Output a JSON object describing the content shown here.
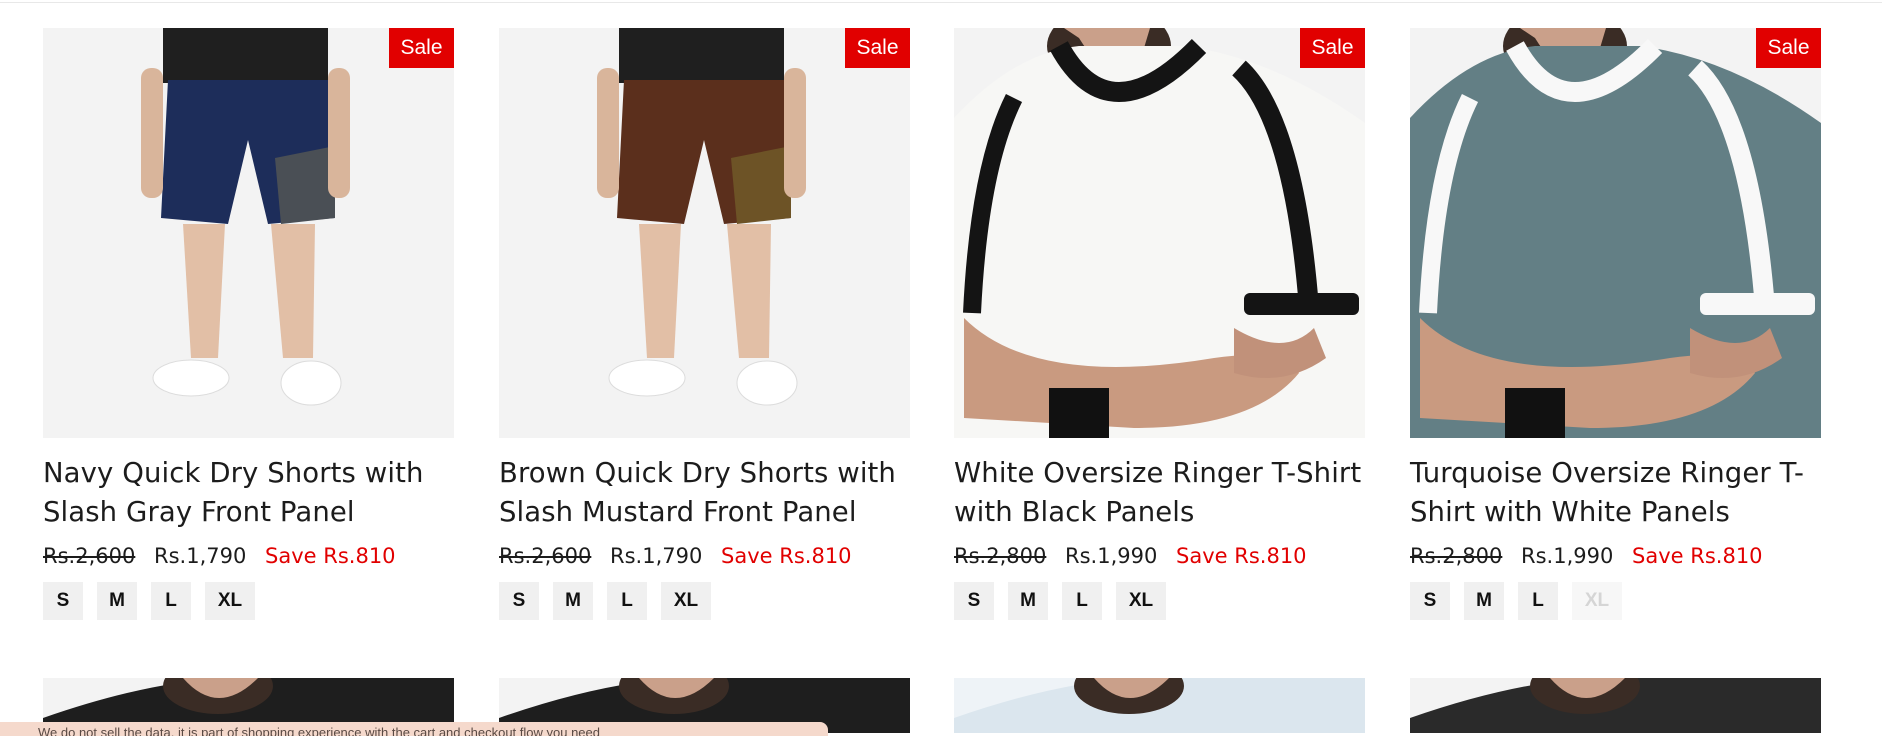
{
  "products": [
    {
      "name": "Navy Quick Dry Shorts with Slash Gray Front Panel",
      "badge": "Sale",
      "old_price": "Rs.2,600",
      "price": "Rs.1,790",
      "save": "Save Rs.810",
      "sizes": [
        {
          "label": "S",
          "available": true
        },
        {
          "label": "M",
          "available": true
        },
        {
          "label": "L",
          "available": true
        },
        {
          "label": "XL",
          "available": true
        }
      ],
      "colors": {
        "main": "#1d2d5a",
        "panel": "#4a4f55"
      }
    },
    {
      "name": "Brown Quick Dry Shorts with Slash Mustard Front Panel",
      "badge": "Sale",
      "old_price": "Rs.2,600",
      "price": "Rs.1,790",
      "save": "Save Rs.810",
      "sizes": [
        {
          "label": "S",
          "available": true
        },
        {
          "label": "M",
          "available": true
        },
        {
          "label": "L",
          "available": true
        },
        {
          "label": "XL",
          "available": true
        }
      ],
      "colors": {
        "main": "#5b2f1c",
        "panel": "#6d5326"
      }
    },
    {
      "name": "White Oversize Ringer T-Shirt with Black Panels",
      "badge": "Sale",
      "old_price": "Rs.2,800",
      "price": "Rs.1,990",
      "save": "Save Rs.810",
      "sizes": [
        {
          "label": "S",
          "available": true
        },
        {
          "label": "M",
          "available": true
        },
        {
          "label": "L",
          "available": true
        },
        {
          "label": "XL",
          "available": true
        }
      ],
      "colors": {
        "main": "#f7f7f5",
        "panel": "#141414"
      }
    },
    {
      "name": "Turquoise Oversize Ringer T-Shirt with White Panels",
      "badge": "Sale",
      "old_price": "Rs.2,800",
      "price": "Rs.1,990",
      "save": "Save Rs.810",
      "sizes": [
        {
          "label": "S",
          "available": true
        },
        {
          "label": "M",
          "available": true
        },
        {
          "label": "L",
          "available": true
        },
        {
          "label": "XL",
          "available": false
        }
      ],
      "colors": {
        "main": "#637f85",
        "panel": "#f8f8f8"
      }
    }
  ],
  "cookie_banner": {
    "text": "We do not sell the data, it is part of shopping experience with the cart and checkout flow you need"
  },
  "theme": {
    "sale_red": "#e10000",
    "chip_bg": "#f0f0f0"
  }
}
